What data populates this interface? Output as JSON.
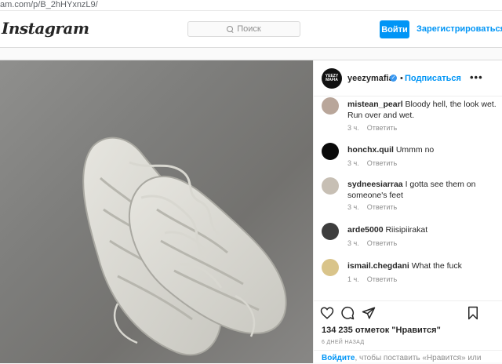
{
  "browser": {
    "url": "am.com/p/B_2hHYxnzL9/"
  },
  "header": {
    "logo": "Instagram",
    "search_placeholder": "Поиск",
    "login_label": "Войти",
    "signup_label": "Зарегистрироваться"
  },
  "post": {
    "username": "yeezymafia",
    "avatar_text": "YEEZY MAFIA",
    "separator": "•",
    "follow_label": "Подписаться",
    "more_label": "•••",
    "likes": "134 235 отметок \"Нравится\"",
    "age": "6 ДНЕЙ НАЗАД",
    "login_link": "Войдите",
    "login_text": ", чтобы поставить «Нравится» или прокомментировать."
  },
  "comments": [
    {
      "user": "mistean_pearl",
      "text": "Bloody hell, the look wet. Run over and wet.",
      "time": "3 ч.",
      "reply": "Ответить"
    },
    {
      "user": "honchx.quil",
      "text": "Ummm no",
      "time": "3 ч.",
      "reply": "Ответить"
    },
    {
      "user": "sydneesiarraa",
      "text": "I gotta see them on someone's feet",
      "time": "3 ч.",
      "reply": "Ответить"
    },
    {
      "user": "arde5000",
      "text": "Riisipiirakat",
      "time": "3 ч.",
      "reply": "Ответить"
    },
    {
      "user": "ismail.chegdani",
      "text": "What the fuck",
      "time": "1 ч.",
      "reply": "Ответить"
    }
  ],
  "colors": {
    "accent": "#0095f6",
    "verified": "#3897f0",
    "text": "#262626",
    "muted": "#8e8e8e",
    "border": "#dbdbdb"
  }
}
